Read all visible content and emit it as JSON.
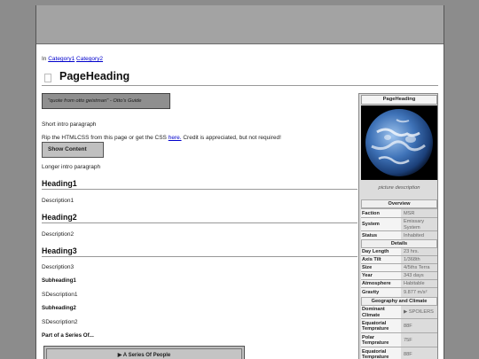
{
  "breadcrumb": {
    "prefix": "In",
    "categories": [
      "Category1",
      "Category2"
    ]
  },
  "page": {
    "title": "PageHeading"
  },
  "quote": "\"quote from otto geistman\" - Otto's Guide",
  "intro": {
    "short": "Short intro paragraph",
    "rip_before": "Rip the HTMLCSS from this page or get the CSS",
    "rip_link": "here.",
    "rip_after": "Credit is appreciated, but not required!"
  },
  "show_content_label": "Show Content",
  "longer_intro": "Longer intro paragraph",
  "sections": [
    {
      "heading": "Heading1",
      "description": "Description1"
    },
    {
      "heading": "Heading2",
      "description": "Description2"
    },
    {
      "heading": "Heading3",
      "description": "Description3"
    }
  ],
  "subsections": [
    {
      "heading": "Subheading1",
      "description": "SDescription1"
    },
    {
      "heading": "Subheading2",
      "description": "SDescription2"
    }
  ],
  "series_label": "Part of a Series Of...",
  "series_button": "▶ A Series Of People",
  "infobox": {
    "title": "PageHeading",
    "caption": "picture description",
    "sections": {
      "overview": "Overview",
      "details": "Details",
      "geo": "Geography and Climate"
    },
    "overview_rows": [
      {
        "k": "Faction",
        "v": "MSR"
      },
      {
        "k": "System",
        "v": "Emissary System"
      },
      {
        "k": "Status",
        "v": "Inhabited"
      }
    ],
    "details_rows": [
      {
        "k": "Day Length",
        "v": "23 hrs."
      },
      {
        "k": "Axis Tilt",
        "v": "1/368th"
      },
      {
        "k": "Size",
        "v": "4/5ths Terra"
      },
      {
        "k": "Year",
        "v": "343 days"
      },
      {
        "k": "Atmosphere",
        "v": "Habitable"
      },
      {
        "k": "Gravity",
        "v": "9.877 m/s²"
      }
    ],
    "geo_rows": [
      {
        "k": "Dominant Climate",
        "v": "▶ SPOILERS"
      },
      {
        "k": "Equatorial Temprature",
        "v": "88F"
      },
      {
        "k": "Polar Temprature",
        "v": "75F"
      },
      {
        "k": "Equatorial Temprature",
        "v": "88F"
      }
    ]
  }
}
